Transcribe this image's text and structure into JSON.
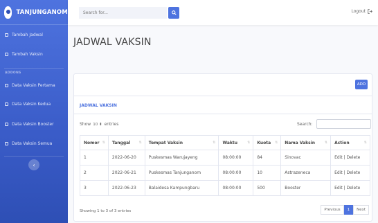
{
  "sidebar": {
    "brand": "TANJUNGANOM",
    "items_top": [
      {
        "label": "Tambah Jadwal"
      },
      {
        "label": "Tambah Vaksin"
      }
    ],
    "section_heading": "ADDONS",
    "items_data": [
      {
        "label": "Data Vaksin Pertama"
      },
      {
        "label": "Data Vaksin Kedua"
      },
      {
        "label": "Data Vaksin Booster"
      },
      {
        "label": "Data Vaksin Semua"
      }
    ]
  },
  "topbar": {
    "search_placeholder": "Search for...",
    "logout_label": "Logout"
  },
  "page": {
    "title": "JADWAL VAKSIN"
  },
  "card": {
    "add_label": "ADD",
    "title": "JADWAL VAKSIN",
    "show_label": "Show",
    "entries_value": "10",
    "entries_label": "entries",
    "search_label": "Search:",
    "columns": [
      "Nomor",
      "Tanggal",
      "Tempat Vaksin",
      "Waktu",
      "Kuota",
      "Nama Vaksin",
      "Action"
    ],
    "rows": [
      [
        "1",
        "2022-06-20",
        "Puskesmas Warujayeng",
        "08:00:00",
        "84",
        "Sinovac",
        "Edit | Delete"
      ],
      [
        "2",
        "2022-06-21",
        "Puskesmas Tanjunganom",
        "08:00:00",
        "10",
        "Astrazeneca",
        "Edit | Delete"
      ],
      [
        "3",
        "2022-06-23",
        "Balaidesa Kampungbaru",
        "08:00:00",
        "500",
        "Booster",
        "Edit | Delete"
      ]
    ],
    "info": "Showing 1 to 3 of 3 entries",
    "pager": {
      "previous": "Previous",
      "current": "1",
      "next": "Next"
    }
  },
  "colors": {
    "primary": "#4e73df",
    "sidebar_bottom": "#2e4fb5"
  },
  "icons": [
    "user-logo-icon",
    "search-icon",
    "logout-icon",
    "chevron-left-icon",
    "calendar-icon",
    "table-icon",
    "sort-icon"
  ]
}
